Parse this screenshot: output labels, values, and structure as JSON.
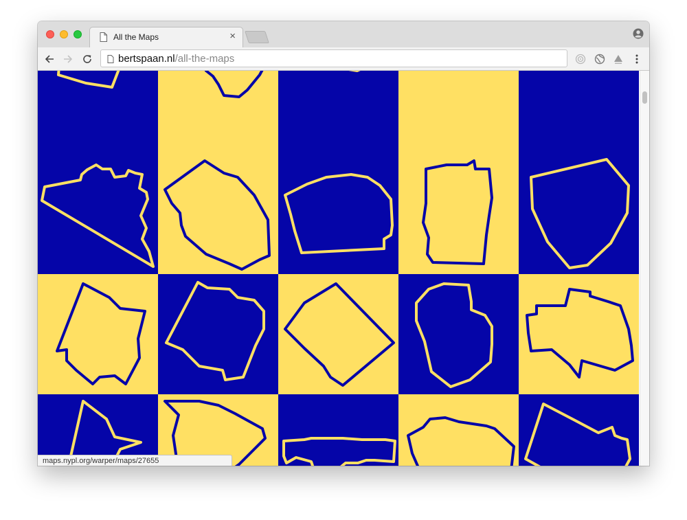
{
  "tab": {
    "title": "All the Maps",
    "close_symbol": "×"
  },
  "address_bar": {
    "domain": "bertspaan.nl",
    "path": "/all-the-maps"
  },
  "status_bar": {
    "text": "maps.nypl.org/warper/maps/27655"
  },
  "colors": {
    "blue": "#0505a8",
    "yellow": "#ffe063"
  },
  "map_grid": {
    "tiles": [
      {
        "fill": "blue",
        "shape": "outline-01"
      },
      {
        "fill": "yellow",
        "shape": "outline-02"
      },
      {
        "fill": "blue",
        "shape": "outline-03"
      },
      {
        "fill": "yellow",
        "shape": "outline-04"
      },
      {
        "fill": "blue",
        "shape": "outline-05"
      },
      {
        "fill": "blue",
        "shape": "outline-06"
      },
      {
        "fill": "yellow",
        "shape": "outline-07"
      },
      {
        "fill": "blue",
        "shape": "outline-08"
      },
      {
        "fill": "yellow",
        "shape": "outline-09"
      },
      {
        "fill": "blue",
        "shape": "outline-10"
      },
      {
        "fill": "yellow",
        "shape": "outline-11"
      },
      {
        "fill": "blue",
        "shape": "outline-12"
      },
      {
        "fill": "yellow",
        "shape": "outline-13"
      },
      {
        "fill": "blue",
        "shape": "outline-14"
      },
      {
        "fill": "yellow",
        "shape": "outline-15"
      },
      {
        "fill": "blue",
        "shape": "outline-16"
      },
      {
        "fill": "yellow",
        "shape": "outline-17"
      },
      {
        "fill": "blue",
        "shape": "outline-18"
      },
      {
        "fill": "yellow",
        "shape": "outline-19"
      },
      {
        "fill": "blue",
        "shape": "outline-20"
      }
    ]
  },
  "icons": {
    "tab": "document-icon",
    "close": "close-icon",
    "profile": "profile-icon",
    "back": "back-arrow-icon",
    "forward": "forward-arrow-icon",
    "reload": "reload-icon",
    "extensions": [
      "target-extension-icon",
      "globe-extension-icon",
      "triangle-extension-icon"
    ],
    "menu": "kebab-menu-icon"
  }
}
